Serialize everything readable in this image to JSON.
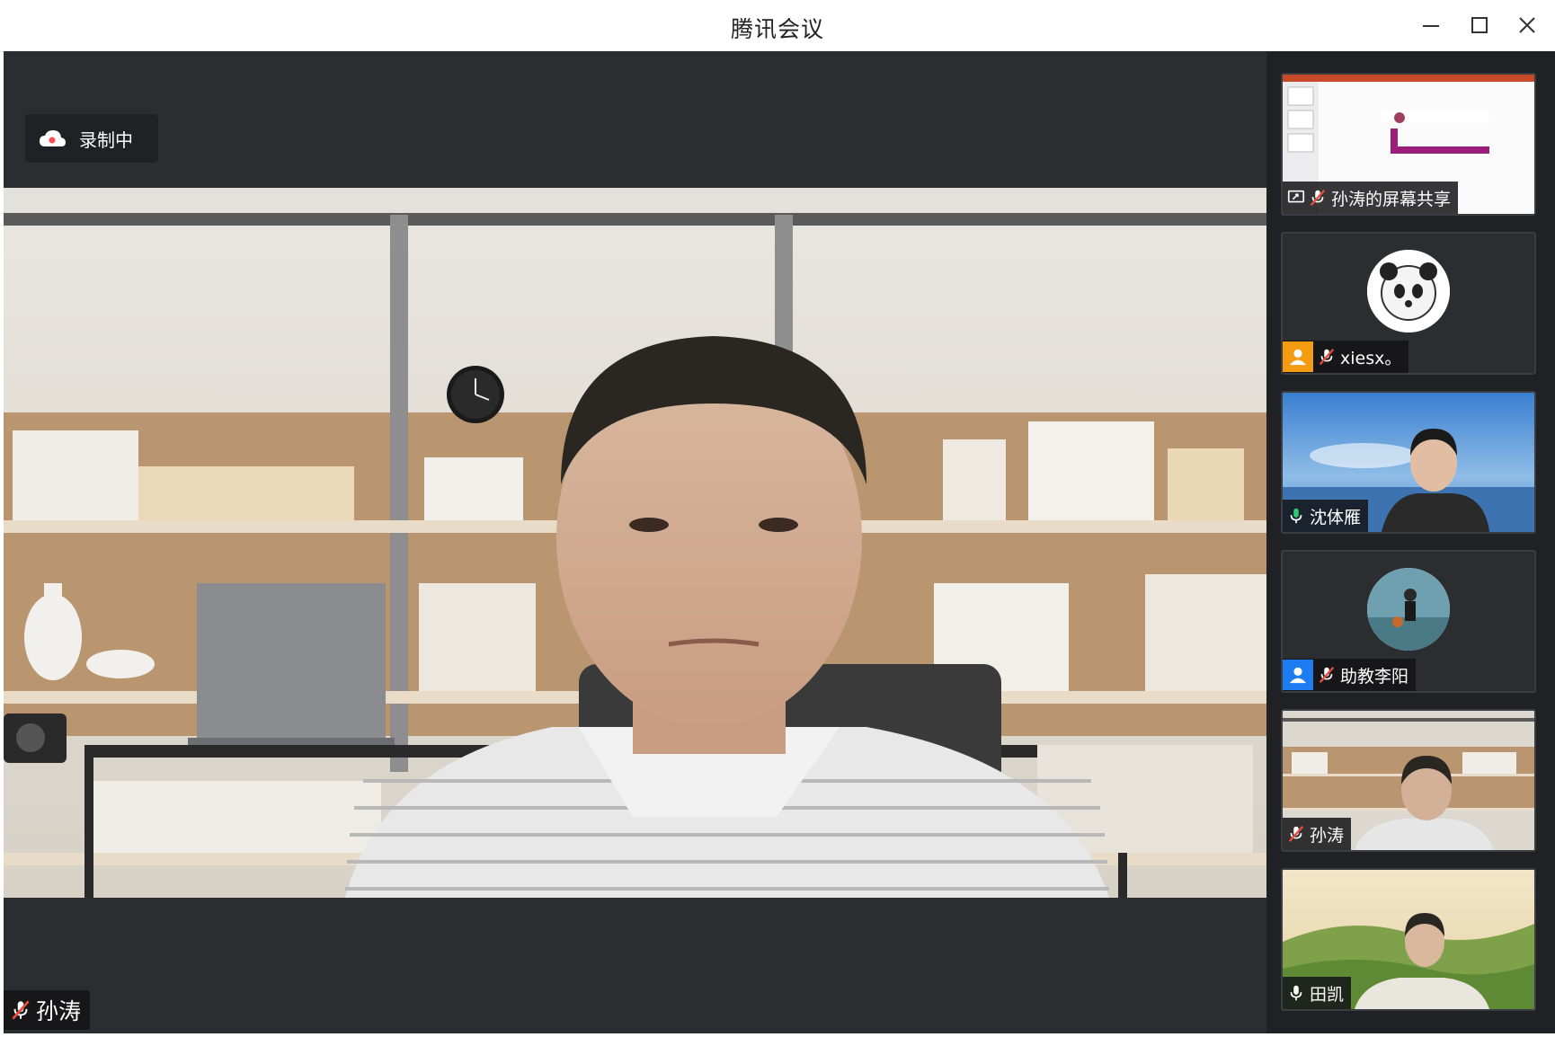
{
  "window": {
    "title": "腾讯会议"
  },
  "recording": {
    "label": "录制中"
  },
  "main_speaker": {
    "name": "孙涛",
    "mic": "muted"
  },
  "participants": [
    {
      "name": "孙涛的屏幕共享",
      "type": "screen-share",
      "mic": "muted"
    },
    {
      "name": "xiesx。",
      "type": "avatar",
      "badge_color": "#f39c12",
      "mic": "muted"
    },
    {
      "name": "沈体雁",
      "type": "video",
      "mic": "active"
    },
    {
      "name": "助教李阳",
      "type": "avatar",
      "badge_color": "#1e7cf2",
      "mic": "muted"
    },
    {
      "name": "孙涛",
      "type": "video",
      "mic": "muted"
    },
    {
      "name": "田凯",
      "type": "video",
      "mic": "on"
    }
  ],
  "colors": {
    "stage_bg": "#2b2d31",
    "sidebar_bg": "#1f2125",
    "mic_muted": "#e74c3c",
    "mic_active": "#2ecc71",
    "rec_cloud": "#ff4d4f"
  }
}
